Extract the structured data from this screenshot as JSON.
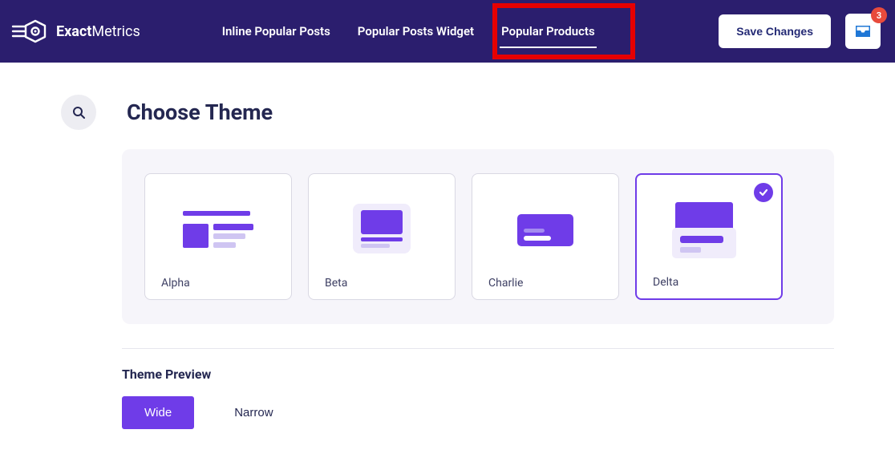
{
  "brand": {
    "name_bold": "Exact",
    "name_light": "Metrics"
  },
  "nav": {
    "items": [
      {
        "label": "Inline Popular Posts",
        "active": false
      },
      {
        "label": "Popular Posts Widget",
        "active": false
      },
      {
        "label": "Popular Products",
        "active": true
      }
    ]
  },
  "header": {
    "save_label": "Save Changes",
    "inbox_badge": "3"
  },
  "page": {
    "title": "Choose Theme"
  },
  "themes": {
    "items": [
      {
        "label": "Alpha"
      },
      {
        "label": "Beta"
      },
      {
        "label": "Charlie"
      },
      {
        "label": "Delta"
      }
    ],
    "selected_index": 3
  },
  "preview": {
    "section_title": "Theme Preview",
    "options": [
      {
        "label": "Wide",
        "active": true
      },
      {
        "label": "Narrow",
        "active": false
      }
    ]
  }
}
